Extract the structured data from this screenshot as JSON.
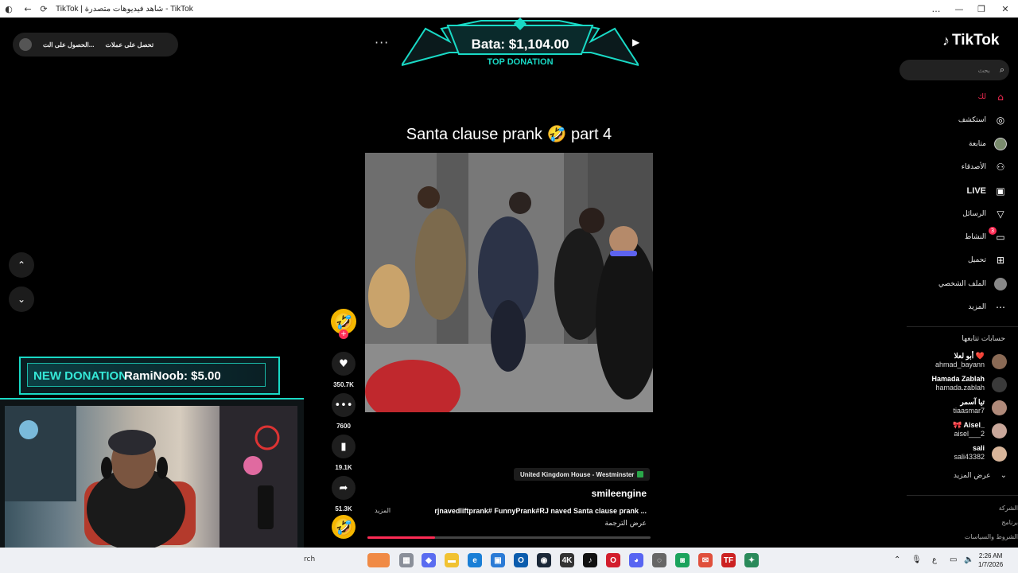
{
  "browser": {
    "title": "TikTok | شاهد فيديوهات متصدرة - TikTok",
    "window_controls": [
      "…",
      "—",
      "❐",
      "✕"
    ]
  },
  "overlay": {
    "coin_pill": {
      "item1": "تحصل على عملات",
      "item2": "الحصول على الت..."
    },
    "top_donation": {
      "amount": "Bata: $1,104.00",
      "label": "TOP DONATION"
    },
    "new_donation": {
      "label": "NEW DONATION",
      "value": "RamiNoob: $5.00"
    }
  },
  "sidebar": {
    "logo": "TikTok",
    "search_placeholder": "بحث",
    "nav": [
      {
        "label": "لك",
        "icon": "home-icon",
        "active": true
      },
      {
        "label": "استكشف",
        "icon": "compass-icon"
      },
      {
        "label": "متابعة",
        "icon": "avatar-icon"
      },
      {
        "label": "الأصدقاء",
        "icon": "friends-icon"
      },
      {
        "label": "LIVE",
        "icon": "live-icon"
      },
      {
        "label": "الرسائل",
        "icon": "messages-icon"
      },
      {
        "label": "النشاط",
        "icon": "activity-icon",
        "badge": "3"
      },
      {
        "label": "تحميل",
        "icon": "upload-icon"
      },
      {
        "label": "الملف الشخصي",
        "icon": "profile-avatar-icon"
      },
      {
        "label": "المزيد",
        "icon": "more-icon"
      }
    ],
    "following_title": "حسابات تتابعها",
    "following": [
      {
        "display": "أبو لعلا ❤️",
        "user": "ahmad_bayann",
        "color": "#8a6a55"
      },
      {
        "display": "Hamada Zablah",
        "user": "hamada.zablah",
        "color": "#3a3a3a"
      },
      {
        "display": "تيا آسمر",
        "user": "tiaasmar7",
        "color": "#b08a7a"
      },
      {
        "display": "🎀 Aisel_",
        "user": "aisel___2",
        "color": "#c9a79a"
      },
      {
        "display": "sali",
        "user": "sali43382",
        "color": "#d8b59a"
      }
    ],
    "see_more": "عرض المزيد",
    "footer": [
      "الشركة",
      "برنامج",
      "الشروط والسياسات"
    ]
  },
  "video": {
    "title": "Santa clause prank 🤣 part 4",
    "more_dots": "···",
    "progress": 0.24,
    "location": "United Kingdom House - Westminster",
    "author": "smileengine",
    "caption": "rjnavedliftprank# FunnyPrank#RJ naved Santa clause prank ...",
    "more": "المزيد",
    "translate": "عرض الترجمة",
    "actions": {
      "likes": "350.7K",
      "comments": "7600",
      "saves": "19.1K",
      "shares": "51.3K"
    }
  },
  "taskbar": {
    "search": "rch",
    "time": "2:26 AM",
    "date": "1/7/2026",
    "lang": "ع"
  },
  "colors": {
    "accent": "#fe2c55",
    "overlay": "#19d9c5"
  }
}
